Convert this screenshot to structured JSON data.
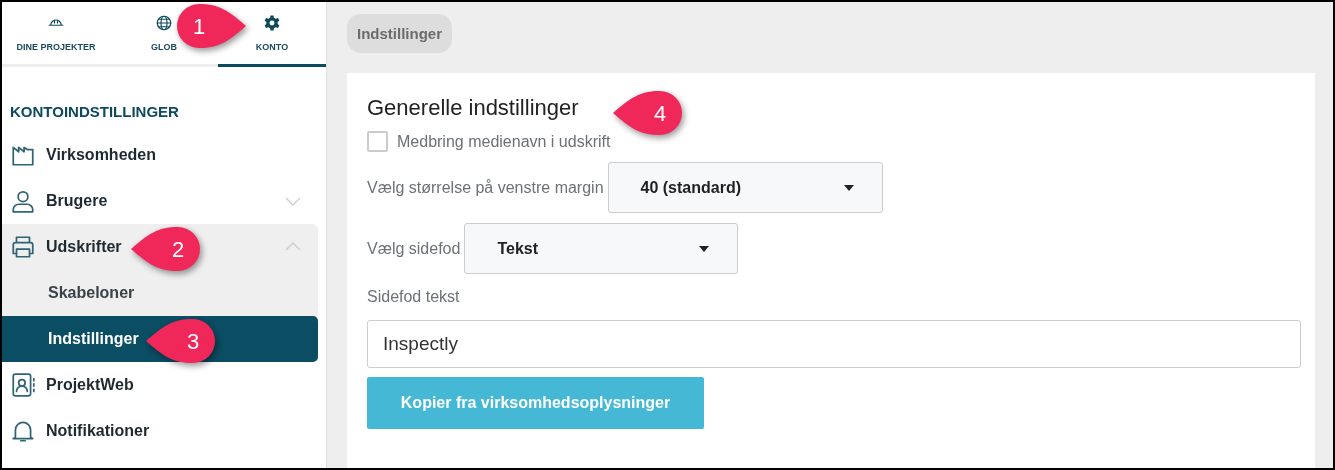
{
  "nav_tabs": [
    {
      "label": "DINE PROJEKTER",
      "selected": false
    },
    {
      "label": "GLOB",
      "selected": false
    },
    {
      "label": "KONTO",
      "selected": true
    }
  ],
  "sidebar": {
    "heading": "KONTOINDSTILLINGER",
    "items": [
      {
        "label": "Virksomheden",
        "selected": false
      },
      {
        "label": "Brugere",
        "selected": false,
        "expanded": false
      },
      {
        "label": "Udskrifter",
        "selected": false,
        "expanded": true,
        "children": [
          {
            "label": "Skabeloner",
            "selected": false
          },
          {
            "label": "Indstillinger",
            "selected": true
          }
        ]
      },
      {
        "label": "ProjektWeb",
        "selected": false
      },
      {
        "label": "Notifikationer",
        "selected": false
      }
    ]
  },
  "breadcrumb": "Indstillinger",
  "settings": {
    "title": "Generelle indstillinger",
    "checkbox": {
      "label": "Medbring medienavn i udskrift",
      "checked": false
    },
    "selects": [
      {
        "label": "Vælg størrelse på venstre margin",
        "value": "40 (standard)"
      },
      {
        "label": "Vælg sidefod",
        "value": "Tekst"
      }
    ],
    "footer_text": {
      "label": "Sidefod tekst",
      "value": "Inspectly"
    },
    "button": "Kopier fra virksomhedsoplysninger"
  },
  "callouts": [
    {
      "number": "1",
      "kind": "rightward"
    },
    {
      "number": "2",
      "kind": "leftward"
    },
    {
      "number": "3",
      "kind": "leftward"
    },
    {
      "number": "4",
      "kind": "leftward"
    }
  ]
}
